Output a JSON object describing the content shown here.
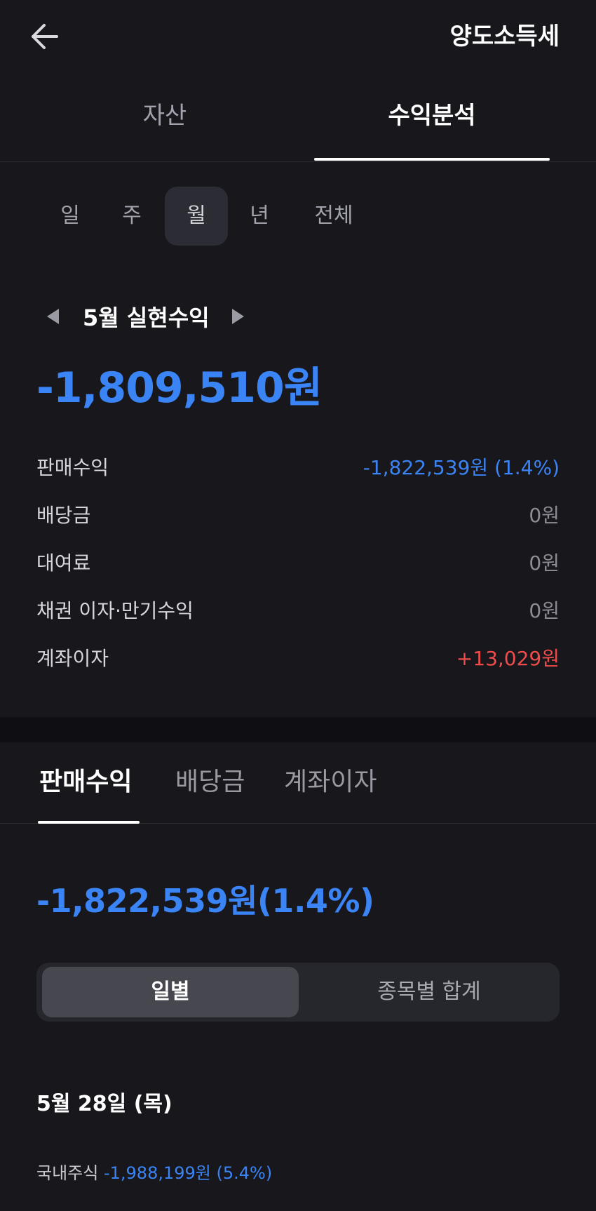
{
  "header": {
    "title": "양도소득세",
    "back_icon": "arrow-left-icon"
  },
  "tabs": [
    {
      "label": "자산",
      "active": false
    },
    {
      "label": "수익분석",
      "active": true
    }
  ],
  "period": {
    "options": [
      "일",
      "주",
      "월",
      "년",
      "전체"
    ],
    "selected": "월"
  },
  "month_nav": {
    "label": "5월 실현수익"
  },
  "realized_total": "-1,809,510원",
  "breakdown": [
    {
      "label": "판매수익",
      "value": "-1,822,539원 (1.4%)"
    },
    {
      "label": "배당금",
      "value": "0원"
    },
    {
      "label": "대여료",
      "value": "0원"
    },
    {
      "label": "채권 이자·만기수익",
      "value": "0원"
    },
    {
      "label": "계좌이자",
      "value": "+13,029원"
    }
  ],
  "sub_tabs": [
    "판매수익",
    "배당금",
    "계좌이자"
  ],
  "sales_total": "-1,822,539원(1.4%)",
  "segment": {
    "daily": "일별",
    "by_stock": "종목별 합계"
  },
  "date_label": "5월 28일 (목)",
  "stock_entry": {
    "label": "국내주식",
    "value": "-1,988,199원 (5.4%)"
  },
  "colors": {
    "background": "#17171c",
    "loss_blue": "#3b84f6",
    "gain_red": "#ef4c4c"
  }
}
